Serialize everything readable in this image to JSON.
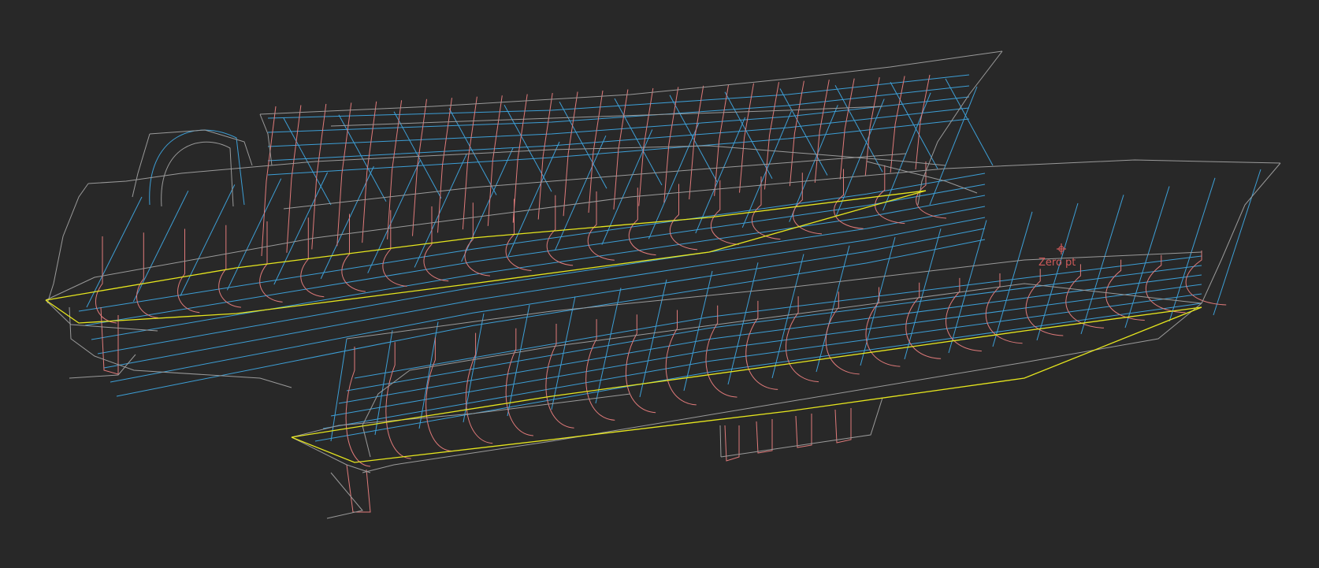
{
  "viewport": {
    "background": "#282828",
    "origin_label": "Zero pt"
  },
  "colors": {
    "outline": "#9a9a9a",
    "station": "#e07a7a",
    "buttock": "#3d9fd6",
    "waterline": "#e6e61e",
    "origin": "#d05a5a"
  },
  "layers": [
    {
      "name": "outline",
      "color_key": "outline"
    },
    {
      "name": "stations",
      "color_key": "station"
    },
    {
      "name": "buttocks",
      "color_key": "buttock"
    },
    {
      "name": "waterline",
      "color_key": "waterline"
    }
  ],
  "icons": {
    "origin": "origin-marker-icon"
  }
}
